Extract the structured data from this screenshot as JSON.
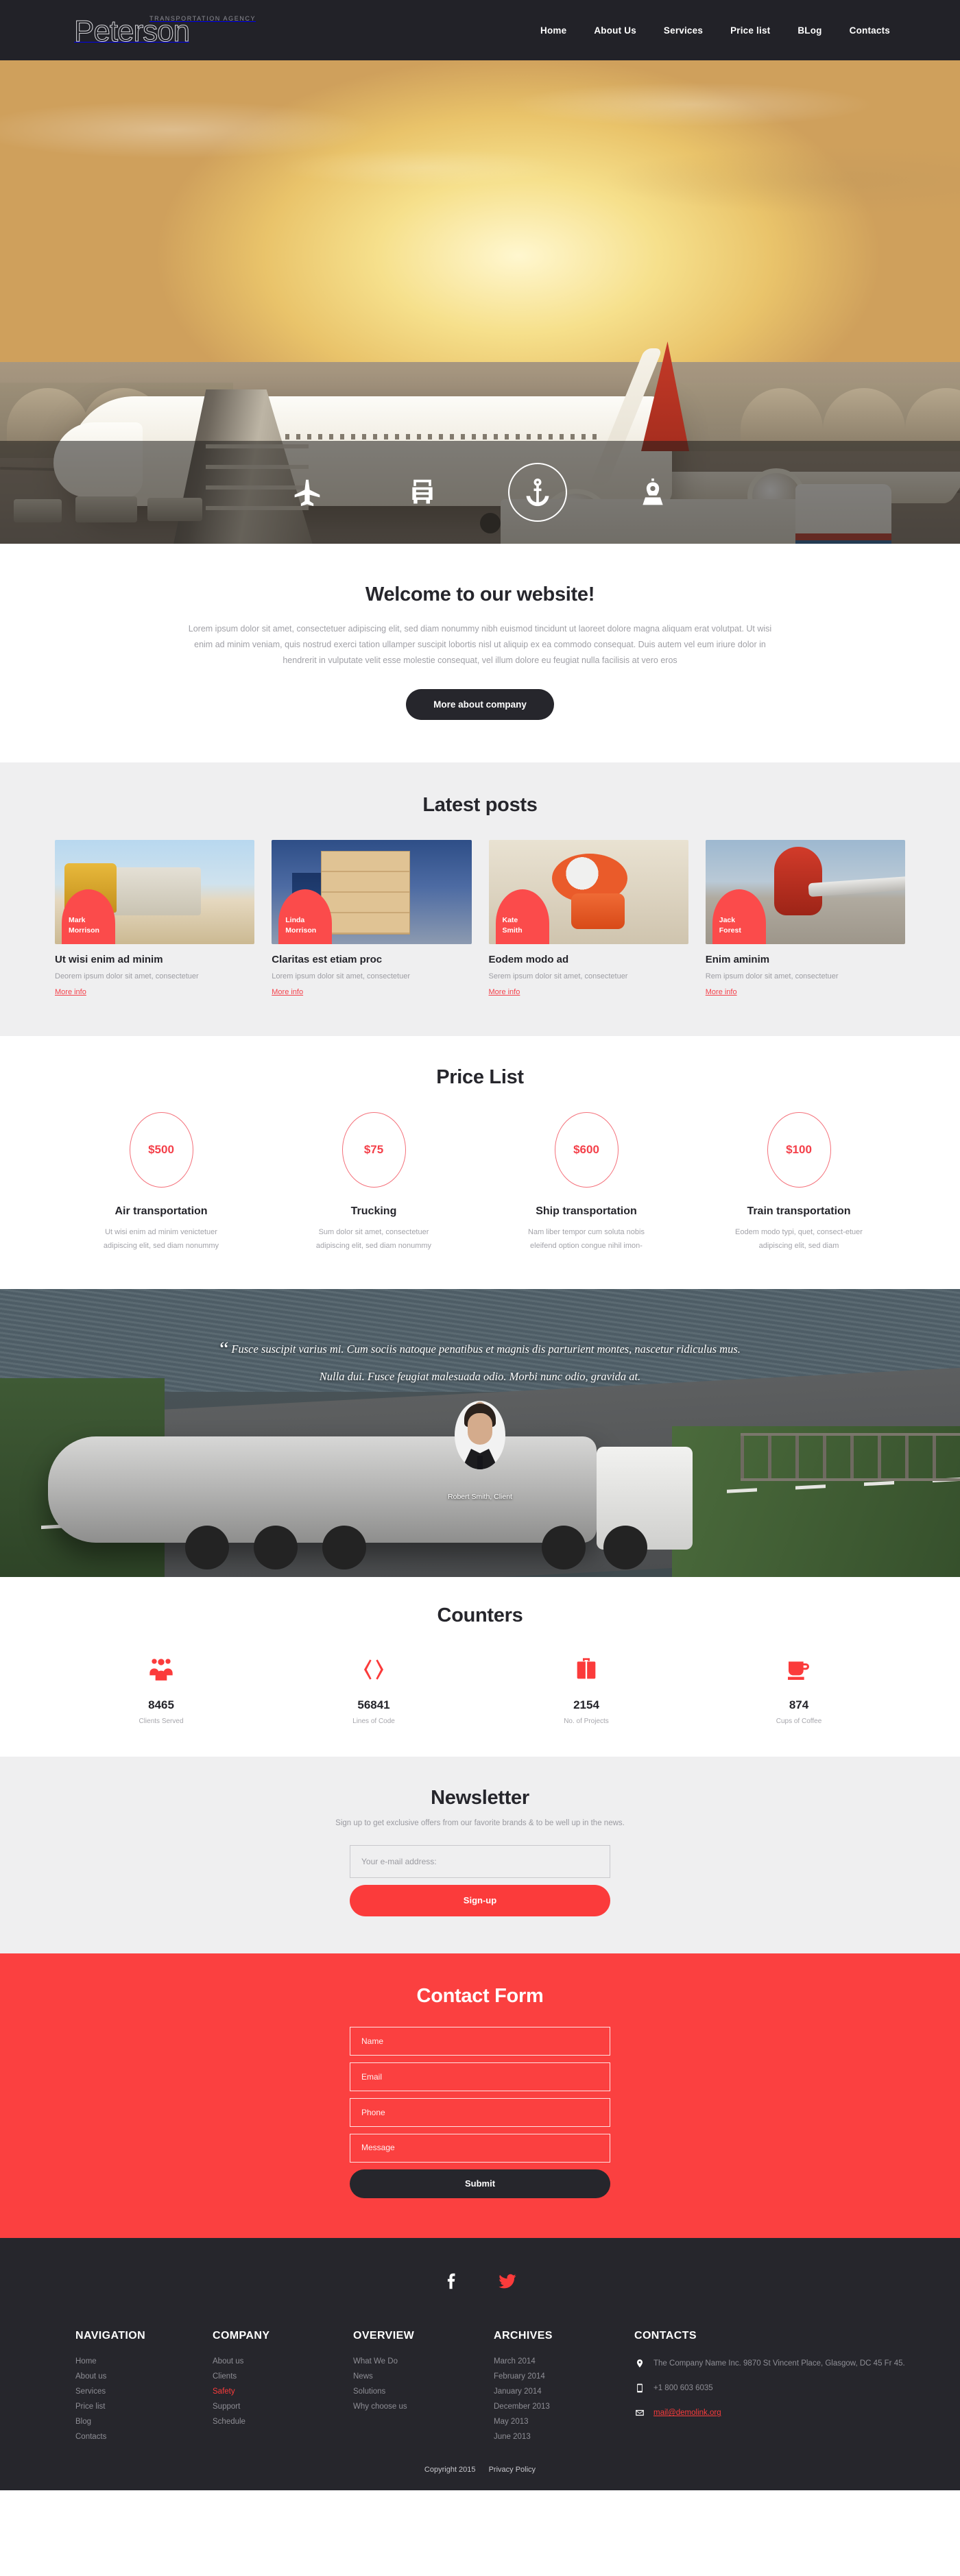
{
  "header": {
    "brand_tagline": "TRANSPORTATION AGENCY",
    "brand_name": "Peterson",
    "nav": [
      {
        "label": "Home",
        "active": true
      },
      {
        "label": "About Us",
        "active": false
      },
      {
        "label": "Services",
        "active": false
      },
      {
        "label": "Price list",
        "active": false
      },
      {
        "label": "BLog",
        "active": false
      },
      {
        "label": "Contacts",
        "active": false
      }
    ]
  },
  "hero": {
    "icons": [
      {
        "name": "airplane-icon",
        "active": false
      },
      {
        "name": "truck-icon",
        "active": false
      },
      {
        "name": "anchor-icon",
        "active": true
      },
      {
        "name": "train-icon",
        "active": false
      }
    ]
  },
  "welcome": {
    "title": "Welcome to our website!",
    "text": "Lorem ipsum dolor sit amet, consectetuer adipiscing elit, sed diam nonummy nibh euismod tincidunt ut laoreet dolore magna aliquam erat volutpat. Ut wisi enim ad minim veniam, quis nostrud exerci tation ullamper suscipit lobortis nisl ut aliquip ex ea commodo consequat. Duis autem vel eum iriure dolor in hendrerit in vulputate velit esse molestie consequat, vel illum dolore eu feugiat nulla facilisis at vero eros",
    "button": "More about company"
  },
  "posts": {
    "title": "Latest posts",
    "items": [
      {
        "author": "Mark\nMorrison",
        "author_line1": "Mark",
        "author_line2": "Morrison",
        "title": "Ut wisi enim ad minim",
        "desc": "Deorem ipsum dolor sit amet, consectetuer",
        "link": "More info",
        "thumb": "truck-photo"
      },
      {
        "author_line1": "Linda",
        "author_line2": "Morrison",
        "title": "Claritas est etiam proc",
        "desc": "Lorem ipsum dolor sit amet, consectetuer",
        "link": "More info",
        "thumb": "forklift-boxes-photo"
      },
      {
        "author_line1": "Kate",
        "author_line2": "Smith",
        "title": "Eodem modo ad",
        "desc": "Serem ipsum dolor sit amet, consectetuer",
        "link": "More info",
        "thumb": "tape-dispenser-photo"
      },
      {
        "author_line1": "Jack",
        "author_line2": "Forest",
        "title": "Enim aminim",
        "desc": "Rem ipsum dolor sit amet, consectetuer",
        "link": "More info",
        "thumb": "airplane-tail-photo"
      }
    ]
  },
  "price": {
    "title": "Price List",
    "items": [
      {
        "price": "$500",
        "name": "Air transportation",
        "desc": "Ut wisi enim ad minim venictetuer adipiscing elit, sed diam nonummy"
      },
      {
        "price": "$75",
        "name": "Trucking",
        "desc": "Sum dolor sit amet, consectetuer adipiscing elit, sed diam nonummy"
      },
      {
        "price": "$600",
        "name": "Ship transportation",
        "desc": "Nam liber tempor cum soluta nobis eleifend option congue nihil imon-"
      },
      {
        "price": "$100",
        "name": "Train transportation",
        "desc": "Eodem modo typi, quet, consect-etuer adipiscing elit, sed diam"
      }
    ]
  },
  "testimonial": {
    "quote": "Fusce suscipit varius mi. Cum sociis natoque penatibus et magnis dis parturient montes, nascetur ridiculus mus. Nulla dui. Fusce feugiat malesuada odio. Morbi nunc odio, gravida at.",
    "quote_mark": "“",
    "author": "Robert Smith, Client"
  },
  "counters": {
    "title": "Counters",
    "items": [
      {
        "icon": "people-icon",
        "value": "8465",
        "label": "Clients Served"
      },
      {
        "icon": "code-icon",
        "value": "56841",
        "label": "Lines of Code"
      },
      {
        "icon": "briefcase-icon",
        "value": "2154",
        "label": "No. of  Projects"
      },
      {
        "icon": "coffee-cup-icon",
        "value": "874",
        "label": "Cups of Coffee"
      }
    ]
  },
  "newsletter": {
    "title": "Newsletter",
    "subtitle": "Sign up to get exclusive offers from our favorite brands & to be well up in the news.",
    "placeholder": "Your e-mail address:",
    "button": "Sign-up"
  },
  "contact_form": {
    "title": "Contact Form",
    "fields": [
      {
        "placeholder": "Name",
        "name": "name-field"
      },
      {
        "placeholder": "Email",
        "name": "email-field"
      },
      {
        "placeholder": "Phone",
        "name": "phone-field"
      },
      {
        "placeholder": "Message",
        "name": "message-field"
      }
    ],
    "submit": "Submit"
  },
  "footer": {
    "social": [
      {
        "name": "facebook-icon",
        "color": "#ffffff"
      },
      {
        "name": "twitter-icon",
        "color": "#fb3b3b"
      }
    ],
    "columns": [
      {
        "heading": "NAVIGATION",
        "links": [
          {
            "label": "Home",
            "highlight": false
          },
          {
            "label": "About us",
            "highlight": false
          },
          {
            "label": "Services",
            "highlight": false
          },
          {
            "label": "Price list",
            "highlight": false
          },
          {
            "label": "Blog",
            "highlight": false
          },
          {
            "label": "Contacts",
            "highlight": false
          }
        ]
      },
      {
        "heading": "COMPANY",
        "links": [
          {
            "label": "About us",
            "highlight": false
          },
          {
            "label": "Clients",
            "highlight": false
          },
          {
            "label": "Safety",
            "highlight": true
          },
          {
            "label": "Support",
            "highlight": false
          },
          {
            "label": "Schedule",
            "highlight": false
          }
        ]
      },
      {
        "heading": "OVERVIEW",
        "links": [
          {
            "label": "What We Do",
            "highlight": false
          },
          {
            "label": "News",
            "highlight": false
          },
          {
            "label": "Solutions",
            "highlight": false
          },
          {
            "label": "Why choose us",
            "highlight": false
          }
        ]
      },
      {
        "heading": "ARCHIVES",
        "links": [
          {
            "label": "March 2014",
            "highlight": false
          },
          {
            "label": "February 2014",
            "highlight": false
          },
          {
            "label": "January 2014",
            "highlight": false
          },
          {
            "label": "December 2013",
            "highlight": false
          },
          {
            "label": "May 2013",
            "highlight": false
          },
          {
            "label": "June 2013",
            "highlight": false
          }
        ]
      }
    ],
    "contacts": {
      "heading": "CONTACTS",
      "address": "The Company Name Inc. 9870 St Vincent Place, Glasgow, DC 45 Fr 45.",
      "phone": "+1 800 603 6035",
      "email": "mail@demolink.org"
    },
    "copyright": "Copyright 2015",
    "privacy": "Privacy Policy"
  },
  "colors": {
    "accent_red": "#fb3b3b",
    "contact_bg": "#fb4040",
    "dark": "#26262c",
    "light_grey": "#efeff0"
  }
}
